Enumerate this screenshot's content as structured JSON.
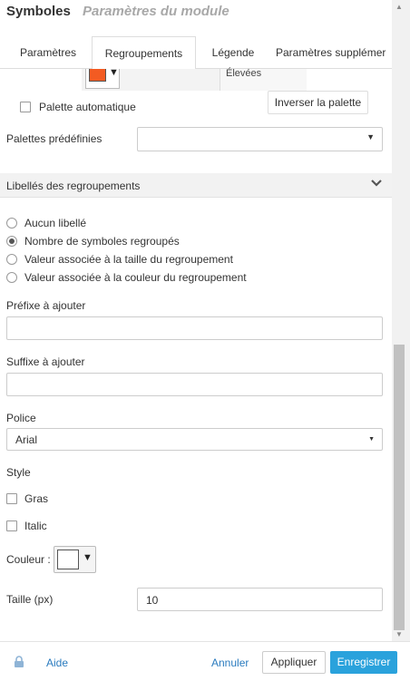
{
  "header": {
    "title": "Symboles",
    "subtitle": "Paramètres du module"
  },
  "tabs": [
    {
      "label": "Paramètres",
      "active": false
    },
    {
      "label": "Regroupements",
      "active": true
    },
    {
      "label": "Légende",
      "active": false
    },
    {
      "label": "Paramètres supplémer",
      "active": false
    }
  ],
  "palette": {
    "swatch_color": "#f35b22",
    "row_label": "Élevées",
    "auto_label": "Palette automatique",
    "auto_checked": false,
    "invert_button": "Inverser la palette",
    "predefined_label": "Palettes prédéfinies",
    "predefined_value": ""
  },
  "labels_section": {
    "title": "Libellés des regroupements",
    "options": [
      {
        "label": "Aucun libellé",
        "selected": false
      },
      {
        "label": "Nombre de symboles regroupés",
        "selected": true
      },
      {
        "label": "Valeur associée à la taille du regroupement",
        "selected": false
      },
      {
        "label": "Valeur associée à la couleur du regroupement",
        "selected": false
      }
    ],
    "prefix_label": "Préfixe à ajouter",
    "prefix_value": "",
    "suffix_label": "Suffixe à ajouter",
    "suffix_value": "",
    "font_label": "Police",
    "font_value": "Arial",
    "style_label": "Style",
    "bold_label": "Gras",
    "bold_checked": false,
    "italic_label": "Italic",
    "italic_checked": false,
    "color_label": "Couleur :",
    "color_value": "#ffffff",
    "size_label": "Taille (px)",
    "size_value": "10"
  },
  "footer": {
    "help": "Aide",
    "cancel": "Annuler",
    "apply": "Appliquer",
    "save": "Enregistrer"
  },
  "colors": {
    "accent": "#2aa2dc",
    "link": "#2a7bbf"
  }
}
